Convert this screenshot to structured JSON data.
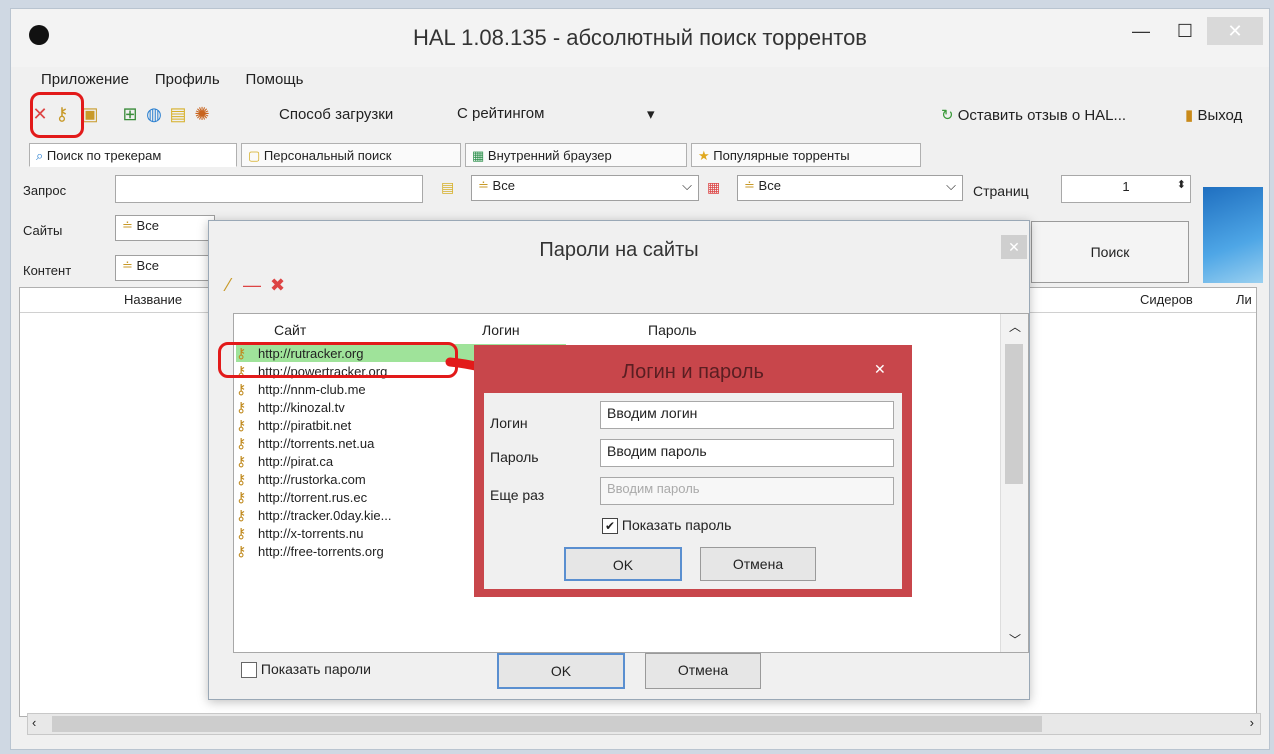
{
  "window": {
    "title": "HAL 1.08.135 - абсолютный поиск торрентов",
    "minimize": "—",
    "maximize": "☐",
    "close": "✕"
  },
  "menu": [
    "Приложение",
    "Профиль",
    "Помощь"
  ],
  "toolbar": {
    "download_mode_label": "Способ загрузки",
    "download_mode_value": "С рейтингом",
    "feedback_link": "Оставить отзыв о HAL...",
    "exit_label": "Выход"
  },
  "tabs": [
    "Поиск по трекерам",
    "Персональный поиск",
    "Внутренний браузер",
    "Популярные торренты"
  ],
  "search": {
    "query_label": "Запрос",
    "sites_label": "Сайты",
    "content_label": "Контент",
    "sites_value": "Все",
    "content_value": "Все",
    "filter1_value": "Все",
    "filter2_value": "Все",
    "pages_label": "Страниц",
    "pages_value": "1",
    "search_button": "Поиск"
  },
  "results": {
    "col_name": "Название",
    "col_seeders": "Сидеров",
    "col_more": "Ли"
  },
  "passwords_dialog": {
    "title": "Пароли на сайты",
    "close": "✕",
    "col_site": "Сайт",
    "col_login": "Логин",
    "col_password": "Пароль",
    "sites": [
      "http://rutracker.org",
      "http://powertracker.org",
      "http://nnm-club.me",
      "http://kinozal.tv",
      "http://piratbit.net",
      "http://torrents.net.ua",
      "http://pirat.ca",
      "http://rustorka.com",
      "http://torrent.rus.ec",
      "http://tracker.0day.kie...",
      "http://x-torrents.nu",
      "http://free-torrents.org"
    ],
    "show_passwords": "Показать пароли",
    "ok": "OK",
    "cancel": "Отмена"
  },
  "login_dialog": {
    "title": "Логин и пароль",
    "close": "✕",
    "login_label": "Логин",
    "password_label": "Пароль",
    "repeat_label": "Еще раз",
    "login_value": "Вводим логин",
    "password_value": "Вводим пароль",
    "repeat_value": "Вводим пароль",
    "show_password": "Показать пароль",
    "ok": "OK",
    "cancel": "Отмена"
  },
  "colors": {
    "accent_red": "#e21a1a",
    "dialog_red": "#c8464b",
    "selection_green": "#9fe39a"
  }
}
